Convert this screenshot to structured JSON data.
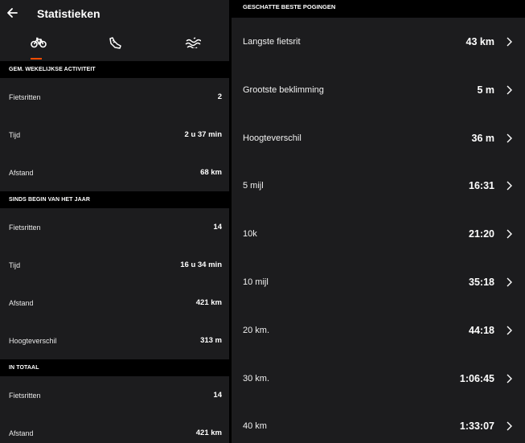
{
  "header": {
    "title": "Statistieken"
  },
  "tabs": [
    {
      "name": "cycling",
      "icon": "bike-icon",
      "active": true
    },
    {
      "name": "running",
      "icon": "shoe-icon",
      "active": false
    },
    {
      "name": "swimming",
      "icon": "waves-icon",
      "active": false
    }
  ],
  "weekly": {
    "header": "GEM. WEKELIJKSE ACTIVITEIT",
    "rows": [
      {
        "label": "Fietsritten",
        "value": "2"
      },
      {
        "label": "Tijd",
        "value": "2 u 37 min"
      },
      {
        "label": "Afstand",
        "value": "68 km"
      }
    ]
  },
  "ytd": {
    "header": "SINDS BEGIN VAN HET JAAR",
    "rows": [
      {
        "label": "Fietsritten",
        "value": "14"
      },
      {
        "label": "Tijd",
        "value": "16 u 34 min"
      },
      {
        "label": "Afstand",
        "value": "421 km"
      },
      {
        "label": "Hoogteverschil",
        "value": "313 m"
      }
    ]
  },
  "total": {
    "header": "IN TOTAAL",
    "rows": [
      {
        "label": "Fietsritten",
        "value": "14"
      },
      {
        "label": "Afstand",
        "value": "421 km"
      }
    ]
  },
  "best": {
    "header": "GESCHATTE BESTE POGINGEN",
    "rows": [
      {
        "label": "Langste fietsrit",
        "value": "43 km"
      },
      {
        "label": "Grootste beklimming",
        "value": "5 m"
      },
      {
        "label": "Hoogteverschil",
        "value": "36 m"
      },
      {
        "label": "5 mijl",
        "value": "16:31"
      },
      {
        "label": "10k",
        "value": "21:20"
      },
      {
        "label": "10 mijl",
        "value": "35:18"
      },
      {
        "label": "20 km.",
        "value": "44:18"
      },
      {
        "label": "30 km.",
        "value": "1:06:45"
      },
      {
        "label": "40 km",
        "value": "1:33:07"
      }
    ]
  },
  "colors": {
    "accent": "#fc4c02",
    "background": "#1c1c1e",
    "header_bg": "#000000",
    "text": "#ffffff"
  }
}
